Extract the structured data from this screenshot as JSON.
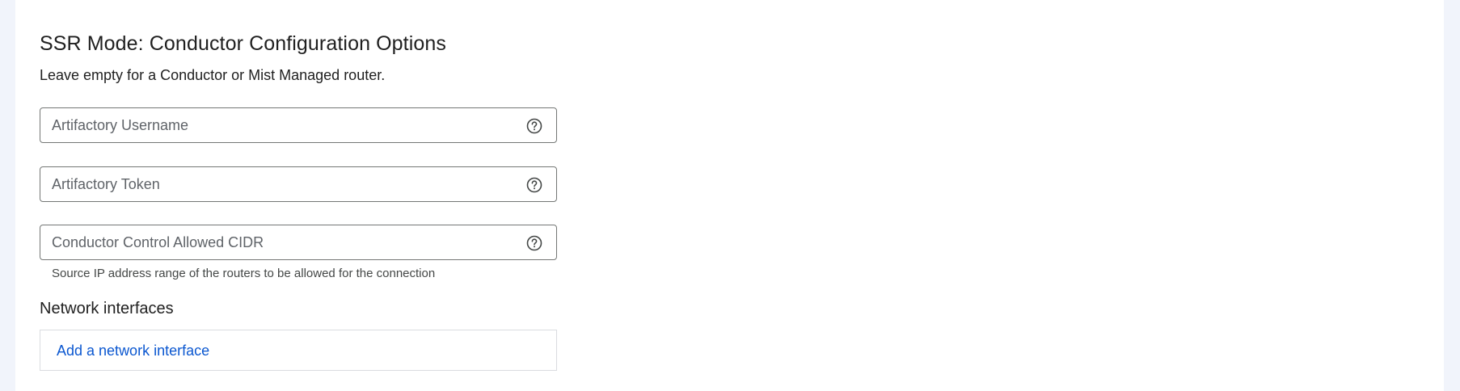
{
  "section": {
    "title": "SSR Mode: Conductor Configuration Options",
    "description": "Leave empty for a Conductor or Mist Managed router."
  },
  "fields": {
    "artifactory_username": {
      "placeholder": "Artifactory Username",
      "value": "",
      "icon": "help-circle-icon"
    },
    "artifactory_token": {
      "placeholder": "Artifactory Token",
      "value": "",
      "icon": "help-circle-icon"
    },
    "conductor_cidr": {
      "placeholder": "Conductor Control Allowed CIDR",
      "value": "",
      "icon": "help-circle-icon",
      "helper": "Source IP address range of the routers to be allowed for the connection"
    }
  },
  "network_interfaces": {
    "title": "Network interfaces",
    "add_label": "Add a network interface"
  },
  "colors": {
    "accent": "#0b57d0",
    "border": "#747775",
    "page_background": "#f1f4fb"
  }
}
